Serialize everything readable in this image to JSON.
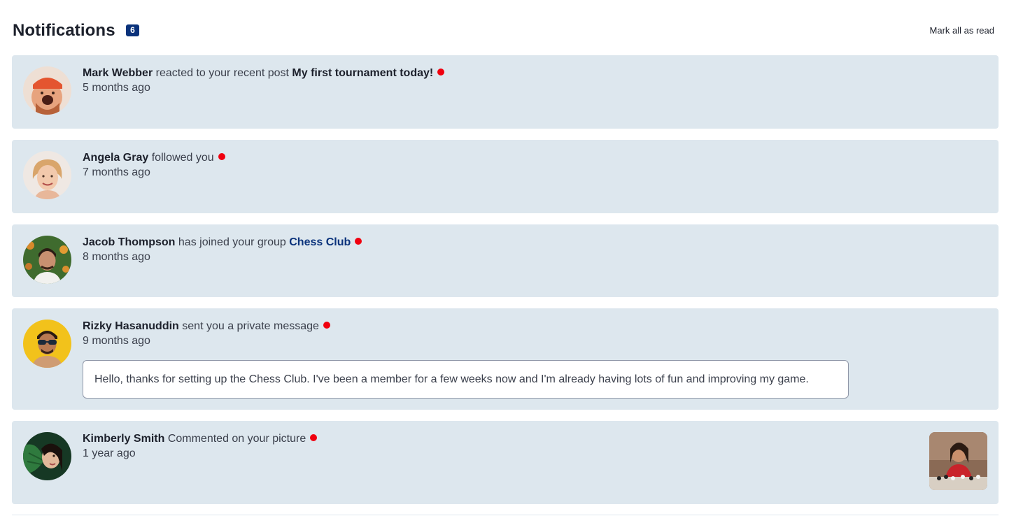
{
  "header": {
    "title": "Notifications",
    "unread_count": "6",
    "mark_all_label": "Mark all as read"
  },
  "colors": {
    "card_background": "#dde7ee",
    "badge": "#0a327b",
    "unread_dot": "#f0000f",
    "group_link": "#0a327b"
  },
  "notifications": [
    {
      "name": "Mark Webber",
      "action": "reacted to your recent post",
      "target": "My first tournament today!",
      "time": "5 months ago",
      "unread": true
    },
    {
      "name": "Angela Gray",
      "action": "followed you",
      "time": "7 months ago",
      "unread": true
    },
    {
      "name": "Jacob Thompson",
      "action": "has joined your group",
      "target": "Chess Club",
      "time": "8 months ago",
      "unread": true
    },
    {
      "name": "Rizky Hasanuddin",
      "action": "sent you a private message",
      "time": "9 months ago",
      "message": "Hello, thanks for setting up the Chess Club. I've been a member for a few weeks now and I'm already having lots of fun and improving my game.",
      "unread": true
    },
    {
      "name": "Kimberly Smith",
      "action": "Commented on your picture",
      "time": "1 year ago",
      "unread": true
    }
  ]
}
